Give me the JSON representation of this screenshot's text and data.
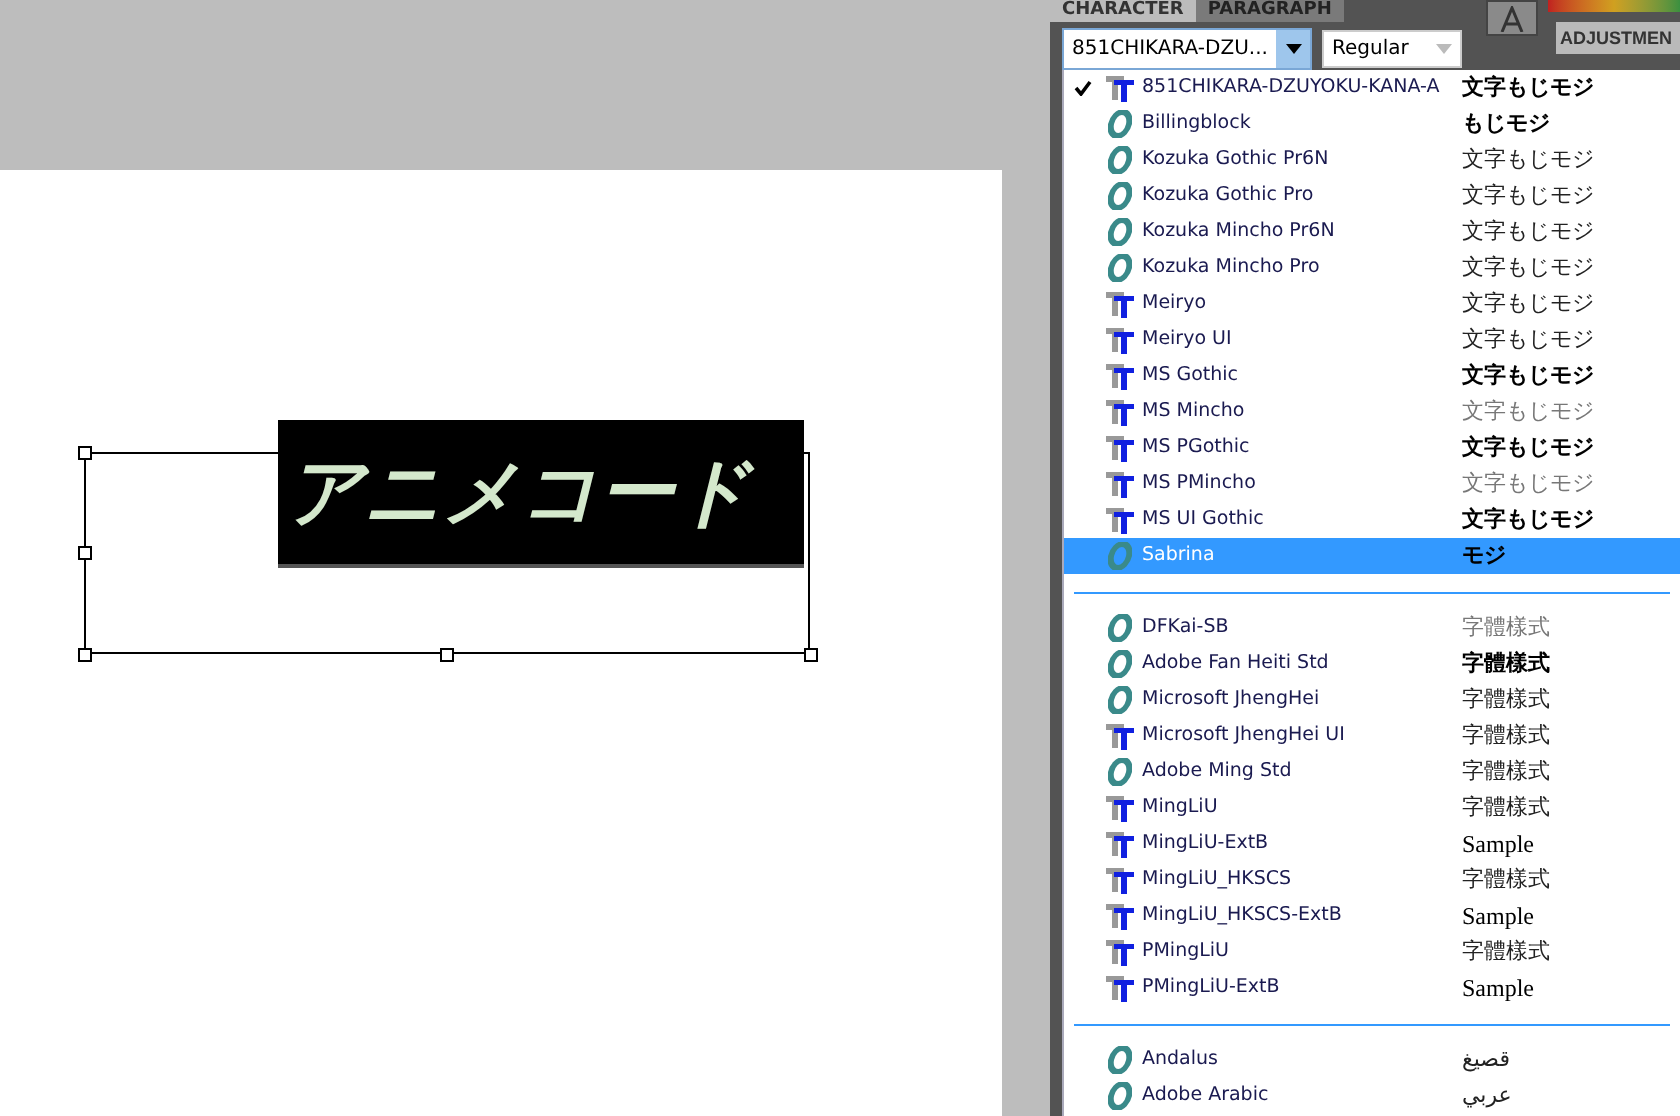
{
  "canvas": {
    "text_frame": {
      "text": "アニメコード",
      "selected": true
    }
  },
  "panel": {
    "tabs": [
      {
        "label": "CHARACTER",
        "selected": true
      },
      {
        "label": "PARAGRAPH",
        "selected": false
      }
    ],
    "font_field": {
      "value": "851CHIKARA-DZU..."
    },
    "style_field": {
      "value": "Regular"
    },
    "side_tab": {
      "label": "ADJUSTMEN"
    }
  },
  "font_menu": {
    "groups": [
      [
        {
          "name": "851CHIKARA-DZUYOKU-KANA-A",
          "sample": "文字もじモジ",
          "kind": "truetype",
          "checked": true,
          "selected": false
        },
        {
          "name": "Billingblock",
          "sample": "もじモジ",
          "kind": "opentype",
          "checked": false,
          "selected": false
        },
        {
          "name": "Kozuka Gothic Pr6N",
          "sample": "文字もじモジ",
          "kind": "opentype",
          "checked": false,
          "selected": false
        },
        {
          "name": "Kozuka Gothic Pro",
          "sample": "文字もじモジ",
          "kind": "opentype",
          "checked": false,
          "selected": false
        },
        {
          "name": "Kozuka Mincho Pr6N",
          "sample": "文字もじモジ",
          "kind": "opentype",
          "checked": false,
          "selected": false
        },
        {
          "name": "Kozuka Mincho Pro",
          "sample": "文字もじモジ",
          "kind": "opentype",
          "checked": false,
          "selected": false
        },
        {
          "name": "Meiryo",
          "sample": "文字もじモジ",
          "kind": "truetype",
          "checked": false,
          "selected": false
        },
        {
          "name": "Meiryo UI",
          "sample": "文字もじモジ",
          "kind": "truetype",
          "checked": false,
          "selected": false
        },
        {
          "name": "MS Gothic",
          "sample": "文字もじモジ",
          "kind": "truetype",
          "checked": false,
          "selected": false
        },
        {
          "name": "MS Mincho",
          "sample": "文字もじモジ",
          "kind": "truetype",
          "checked": false,
          "selected": false
        },
        {
          "name": "MS PGothic",
          "sample": "文字もじモジ",
          "kind": "truetype",
          "checked": false,
          "selected": false
        },
        {
          "name": "MS PMincho",
          "sample": "文字もじモジ",
          "kind": "truetype",
          "checked": false,
          "selected": false
        },
        {
          "name": "MS UI Gothic",
          "sample": "文字もじモジ",
          "kind": "truetype",
          "checked": false,
          "selected": false
        },
        {
          "name": "Sabrina",
          "sample": "モジ",
          "kind": "opentype",
          "checked": false,
          "selected": true
        }
      ],
      [
        {
          "name": "DFKai-SB",
          "sample": "字體樣式",
          "kind": "opentype",
          "checked": false,
          "selected": false
        },
        {
          "name": "Adobe Fan Heiti Std",
          "sample": "字體樣式",
          "kind": "opentype",
          "checked": false,
          "selected": false
        },
        {
          "name": "Microsoft JhengHei",
          "sample": "字體樣式",
          "kind": "opentype",
          "checked": false,
          "selected": false
        },
        {
          "name": "Microsoft JhengHei UI",
          "sample": "字體樣式",
          "kind": "truetype",
          "checked": false,
          "selected": false
        },
        {
          "name": "Adobe Ming Std",
          "sample": "字體樣式",
          "kind": "opentype",
          "checked": false,
          "selected": false
        },
        {
          "name": "MingLiU",
          "sample": "字體樣式",
          "kind": "truetype",
          "checked": false,
          "selected": false
        },
        {
          "name": "MingLiU-ExtB",
          "sample": "Sample",
          "kind": "truetype",
          "checked": false,
          "selected": false
        },
        {
          "name": "MingLiU_HKSCS",
          "sample": "字體樣式",
          "kind": "truetype",
          "checked": false,
          "selected": false
        },
        {
          "name": "MingLiU_HKSCS-ExtB",
          "sample": "Sample",
          "kind": "truetype",
          "checked": false,
          "selected": false
        },
        {
          "name": "PMingLiU",
          "sample": "字體樣式",
          "kind": "truetype",
          "checked": false,
          "selected": false
        },
        {
          "name": "PMingLiU-ExtB",
          "sample": "Sample",
          "kind": "truetype",
          "checked": false,
          "selected": false
        }
      ],
      [
        {
          "name": "Andalus",
          "sample": "قصيغ",
          "kind": "opentype",
          "checked": false,
          "selected": false
        },
        {
          "name": "Adobe Arabic",
          "sample": "عربي",
          "kind": "opentype",
          "checked": false,
          "selected": false
        }
      ]
    ]
  }
}
